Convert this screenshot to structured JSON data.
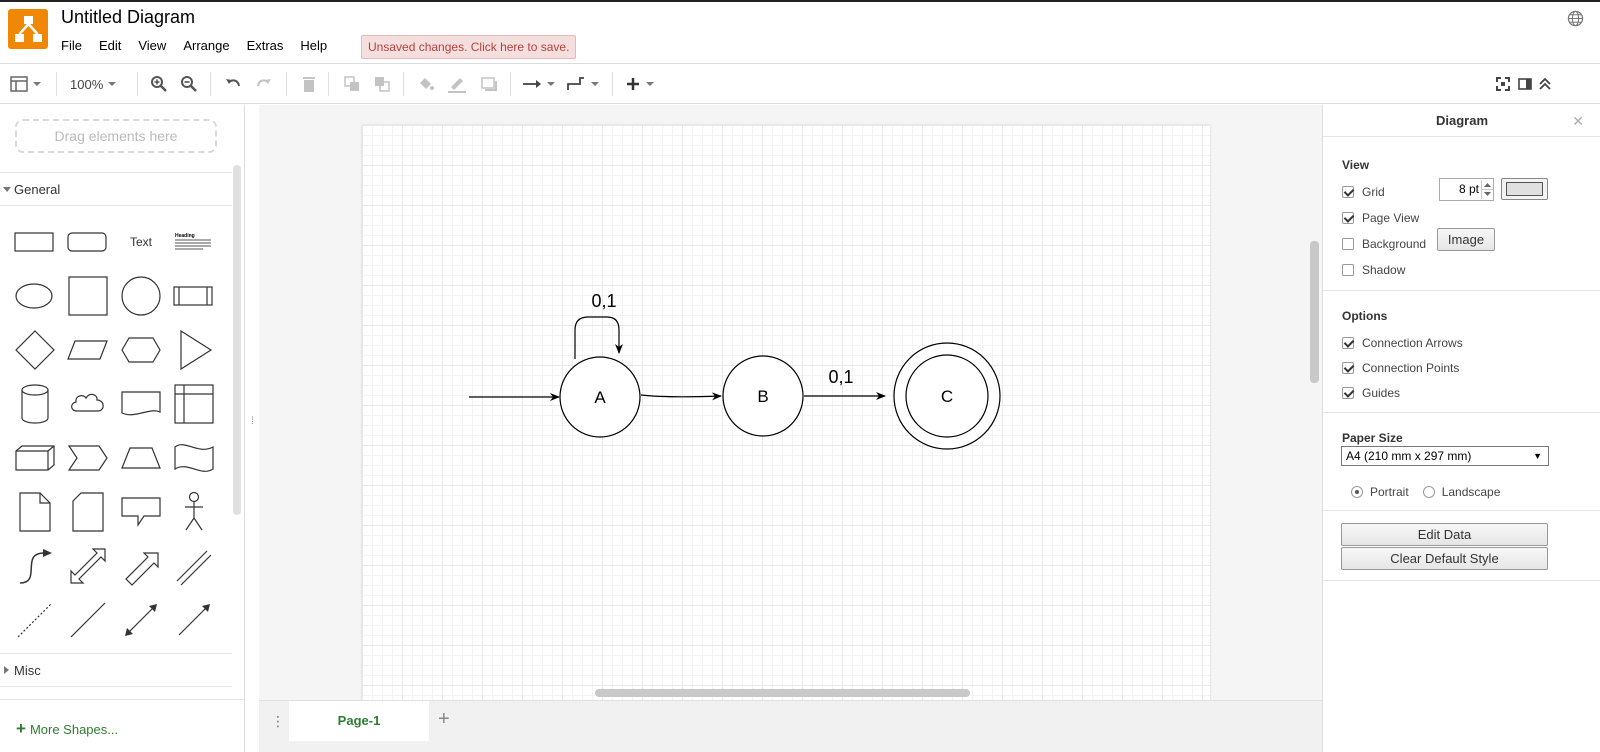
{
  "app": {
    "title": "Untitled Diagram",
    "unsaved_notice": "Unsaved changes. Click here to save.",
    "brand_color": "#f08705"
  },
  "menubar": {
    "items": [
      "File",
      "Edit",
      "View",
      "Arrange",
      "Extras",
      "Help"
    ]
  },
  "toolbar": {
    "zoom": "100%",
    "icons": [
      "format-panel-icon",
      "zoom-in-icon",
      "zoom-out-icon",
      "undo-icon",
      "redo-icon",
      "delete-icon",
      "to-front-icon",
      "to-back-icon",
      "fill-color-icon",
      "line-color-icon",
      "shadow-icon",
      "connection-icon",
      "waypoints-icon",
      "insert-icon",
      "fullscreen-icon",
      "toggle-panel-icon",
      "collapse-icon"
    ]
  },
  "sidebar": {
    "drop_zone": "Drag elements here",
    "sections": [
      {
        "label": "General",
        "expanded": true
      },
      {
        "label": "Misc",
        "expanded": false
      }
    ],
    "text_shape_label": "Text",
    "heading_shape_label": "Heading",
    "more_shapes": "More Shapes..."
  },
  "diagram": {
    "nodes": [
      {
        "id": "A",
        "label": "A",
        "accepting": false
      },
      {
        "id": "B",
        "label": "B",
        "accepting": false
      },
      {
        "id": "C",
        "label": "C",
        "accepting": true
      }
    ],
    "edges": [
      {
        "from": "start",
        "to": "A",
        "label": ""
      },
      {
        "from": "A",
        "to": "A",
        "label": "0,1"
      },
      {
        "from": "A",
        "to": "B",
        "label": ""
      },
      {
        "from": "B",
        "to": "C",
        "label": "0,1"
      }
    ]
  },
  "pagebar": {
    "current_page": "Page-1"
  },
  "format_panel": {
    "title": "Diagram",
    "view": {
      "heading": "View",
      "grid": {
        "label": "Grid",
        "checked": true,
        "size": "8 pt"
      },
      "page_view": {
        "label": "Page View",
        "checked": true
      },
      "background": {
        "label": "Background",
        "checked": false,
        "button": "Image"
      },
      "shadow": {
        "label": "Shadow",
        "checked": false
      }
    },
    "options": {
      "heading": "Options",
      "connection_arrows": {
        "label": "Connection Arrows",
        "checked": true
      },
      "connection_points": {
        "label": "Connection Points",
        "checked": true
      },
      "guides": {
        "label": "Guides",
        "checked": true
      }
    },
    "paper": {
      "heading": "Paper Size",
      "size": "A4 (210 mm x 297 mm)",
      "portrait": "Portrait",
      "landscape": "Landscape",
      "orientation": "portrait"
    },
    "buttons": {
      "edit_data": "Edit Data",
      "clear_style": "Clear Default Style"
    }
  }
}
